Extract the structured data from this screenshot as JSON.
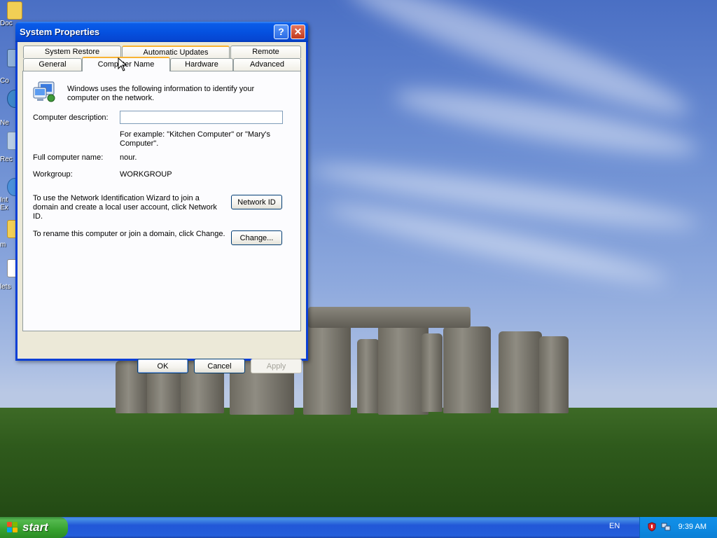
{
  "window": {
    "title": "System Properties",
    "help_glyph": "?",
    "close_glyph": "✕"
  },
  "tabs": {
    "row1": [
      "System Restore",
      "Automatic Updates",
      "Remote"
    ],
    "row2": [
      "General",
      "Computer Name",
      "Hardware",
      "Advanced"
    ],
    "active": "Computer Name"
  },
  "computer_name_tab": {
    "intro": "Windows uses the following information to identify your computer on the network.",
    "description_label": "Computer description:",
    "description_value": "",
    "example_text": "For example: \"Kitchen Computer\" or \"Mary's Computer\".",
    "full_name_label": "Full computer name:",
    "full_name_value": "nour.",
    "workgroup_label": "Workgroup:",
    "workgroup_value": "WORKGROUP",
    "network_id_text": "To use the Network Identification Wizard to join a domain and create a local user account, click Network ID.",
    "network_id_button": "Network ID",
    "rename_text": "To rename this computer or join a domain, click Change.",
    "change_button": "Change..."
  },
  "dialog_buttons": {
    "ok": "OK",
    "cancel": "Cancel",
    "apply": "Apply"
  },
  "taskbar": {
    "start_label": "start",
    "language": "EN",
    "clock": "9:39 AM"
  },
  "desktop_icons": [
    {
      "label": "Doc",
      "icon": "folder-icon"
    },
    {
      "label": "Co",
      "icon": "computer-icon"
    },
    {
      "label": "Ne",
      "icon": "network-icon"
    },
    {
      "label": "Rec",
      "icon": "recycle-bin-icon"
    },
    {
      "label": "Int\nEx",
      "icon": "internet-explorer-icon"
    },
    {
      "label": "m",
      "icon": "folder-icon"
    },
    {
      "label": "lets",
      "icon": "document-icon"
    }
  ],
  "colors": {
    "title_bar": "#0551e0",
    "dialog_face": "#ece9d8",
    "tab_highlight": "#f8b333",
    "start_button": "#37a22f"
  }
}
